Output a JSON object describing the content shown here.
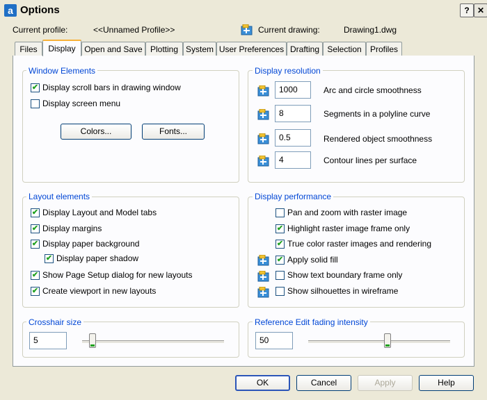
{
  "window": {
    "title": "Options"
  },
  "header": {
    "profile_label": "Current profile:",
    "profile_value": "<<Unnamed Profile>>",
    "drawing_label": "Current drawing:",
    "drawing_value": "Drawing1.dwg"
  },
  "tabs": [
    {
      "label": "Files",
      "active": false
    },
    {
      "label": "Display",
      "active": true
    },
    {
      "label": "Open and Save",
      "active": false
    },
    {
      "label": "Plotting",
      "active": false
    },
    {
      "label": "System",
      "active": false
    },
    {
      "label": "User Preferences",
      "active": false
    },
    {
      "label": "Drafting",
      "active": false
    },
    {
      "label": "Selection",
      "active": false
    },
    {
      "label": "Profiles",
      "active": false
    }
  ],
  "window_elements": {
    "title": "Window Elements",
    "options": [
      {
        "label": "Display scroll bars in drawing window",
        "checked": true
      },
      {
        "label": "Display screen menu",
        "checked": false
      }
    ],
    "colors_button": "Colors...",
    "fonts_button": "Fonts..."
  },
  "display_resolution": {
    "title": "Display resolution",
    "fields": [
      {
        "value": "1000",
        "label": "Arc and circle smoothness"
      },
      {
        "value": "8",
        "label": "Segments in a polyline curve"
      },
      {
        "value": "0.5",
        "label": "Rendered object smoothness"
      },
      {
        "value": "4",
        "label": "Contour lines per surface"
      }
    ]
  },
  "layout_elements": {
    "title": "Layout elements",
    "options": [
      {
        "label": "Display Layout and Model tabs",
        "checked": true
      },
      {
        "label": "Display margins",
        "checked": true
      },
      {
        "label": "Display paper background",
        "checked": true
      },
      {
        "label": "Display paper shadow",
        "checked": true
      },
      {
        "label": "Show Page Setup dialog for new layouts",
        "checked": true
      },
      {
        "label": "Create viewport in new layouts",
        "checked": true
      }
    ]
  },
  "display_performance": {
    "title": "Display performance",
    "options": [
      {
        "label": "Pan and zoom with raster image",
        "checked": false
      },
      {
        "label": "Highlight raster image frame only",
        "checked": true
      },
      {
        "label": "True color raster images and rendering",
        "checked": true
      },
      {
        "label": "Apply solid fill",
        "checked": true
      },
      {
        "label": "Show text boundary frame only",
        "checked": false
      },
      {
        "label": "Show silhouettes in wireframe",
        "checked": false
      }
    ]
  },
  "crosshair": {
    "title": "Crosshair size",
    "value": "5",
    "slider_fraction": 0.05
  },
  "ref_edit": {
    "title": "Reference Edit fading intensity",
    "value": "50",
    "slider_fraction": 0.56
  },
  "footer": {
    "ok": "OK",
    "cancel": "Cancel",
    "apply": "Apply",
    "help": "Help"
  },
  "icons": {
    "drawing": "drawing-saved-icon",
    "app": "autocad-icon"
  },
  "colors": {
    "accent": "#0046D5",
    "check": "#21A121",
    "tab_highlight": "#F7B138",
    "icon_blue": "#3A8FD8",
    "icon_yellow": "#F2C230"
  }
}
